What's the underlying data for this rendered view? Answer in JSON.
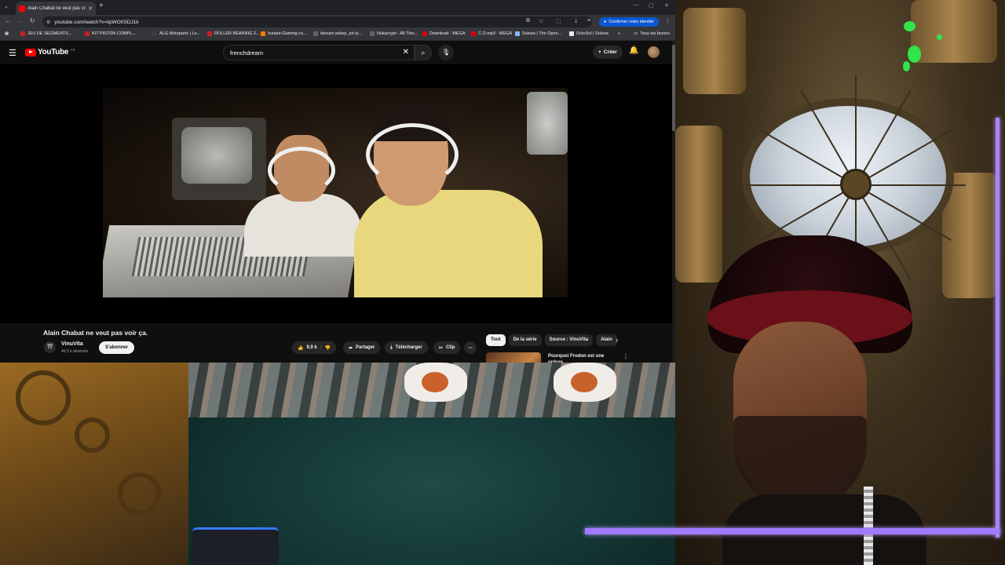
{
  "browser": {
    "tab_title": "Alain Chabat ne veut pas voir ça",
    "url": "youtube.com/watch?v=iipWO0SDJ1k",
    "confirm_identity": "Confirmer votre identité",
    "bookmarks": [
      {
        "label": "JEU DE SEGMENTS...",
        "color": "#c5221f"
      },
      {
        "label": "KIT PISTON COMPL...",
        "color": "#c5221f"
      },
      {
        "label": "ALG Motoparts | Le...",
        "color": "#3c4043"
      },
      {
        "label": "ROLLER BEARING 2...",
        "color": "#c5221f"
      },
      {
        "label": "Instant-Gaming co...",
        "color": "#f57c00"
      },
      {
        "label": "ideoart.sebep_art.ty...",
        "color": "#5f6368"
      },
      {
        "label": "Nukacrypt - All Thin...",
        "color": "#5f6368"
      },
      {
        "label": "Download - MEGA",
        "color": "#d90007"
      },
      {
        "label": "C.O.mp3 - MEGA",
        "color": "#d90007"
      },
      {
        "label": "Solsea | The Open...",
        "color": "#8ab4f8"
      },
      {
        "label": "OctoSol | Solsea",
        "color": "#e8eaed"
      }
    ],
    "all_bookmarks": "Tous les favoris"
  },
  "youtube": {
    "logo": "YouTube",
    "country": "FR",
    "search_query": "frenchdream",
    "create_label": "Créer"
  },
  "video": {
    "title": "Alain Chabat ne veut pas voir ça.",
    "channel": "VinuVita",
    "subscribers": "46,5 k abonnés",
    "subscribe_label": "S'abonner",
    "likes": "9,9 k",
    "share_label": "Partager",
    "download_label": "Télécharger",
    "clip_label": "Clip"
  },
  "chips": [
    "Tout",
    "De la série",
    "Source : VinuVita",
    "Alain"
  ],
  "recommendation": {
    "title": "Pourquoi Frodon est une ordure..."
  },
  "colors": {
    "youtube_red": "#ff0000",
    "overlay_violet": "#a884ff",
    "splat_green": "#2ee64a"
  }
}
